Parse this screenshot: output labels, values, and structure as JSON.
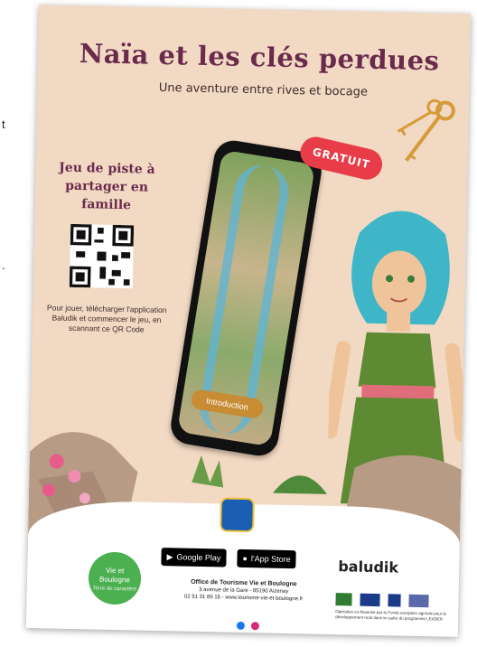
{
  "page_edge": {
    "letter_top": "t",
    "letter_bottom": "."
  },
  "poster": {
    "title": "Naïa et les clés perdues",
    "subtitle": "Une aventure entre rives et bocage",
    "left_title": "Jeu de piste à partager en famille",
    "left_note": "Pour jouer, télécharger l'application Baludik et commencer le jeu, en scannant ce QR Code",
    "badge": "GRATUIT",
    "app_button": "Introduction",
    "google_play": "Google Play",
    "app_store": "l'App Store",
    "vie_logo": {
      "line1": "Vie et",
      "line2": "Boulogne",
      "tag": "Terre de caractère"
    },
    "office": {
      "name": "Office de Tourisme Vie et Boulogne",
      "address": "3 avenue de la Gare - 85190 Aizenay",
      "contact": "02 51 31 89 15 - www.tourisme-vie-et-boulogne.fr"
    },
    "partner": "baludik",
    "funding_text": "Opération co-financée par le Fonds européen agricole pour le développement rural dans le cadre du programme LEADER"
  },
  "colors": {
    "poster_bg": "#f2d9c3",
    "title": "#6a2a4c",
    "badge": "#e83c48",
    "brand_green": "#4caf50"
  }
}
